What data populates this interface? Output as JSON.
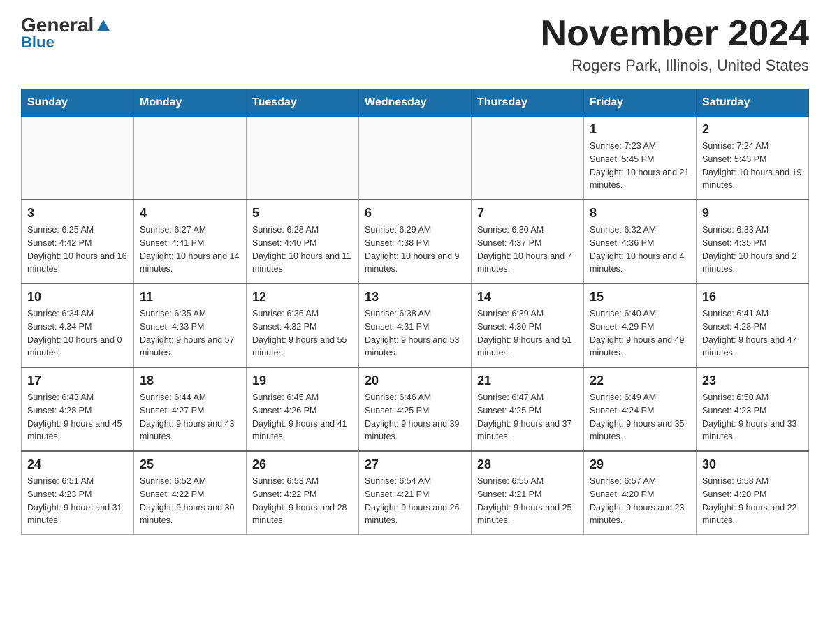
{
  "header": {
    "logo_general": "General",
    "logo_blue": "Blue",
    "month_title": "November 2024",
    "location": "Rogers Park, Illinois, United States"
  },
  "days_of_week": [
    "Sunday",
    "Monday",
    "Tuesday",
    "Wednesday",
    "Thursday",
    "Friday",
    "Saturday"
  ],
  "weeks": [
    [
      {
        "day": "",
        "info": ""
      },
      {
        "day": "",
        "info": ""
      },
      {
        "day": "",
        "info": ""
      },
      {
        "day": "",
        "info": ""
      },
      {
        "day": "",
        "info": ""
      },
      {
        "day": "1",
        "info": "Sunrise: 7:23 AM\nSunset: 5:45 PM\nDaylight: 10 hours and 21 minutes."
      },
      {
        "day": "2",
        "info": "Sunrise: 7:24 AM\nSunset: 5:43 PM\nDaylight: 10 hours and 19 minutes."
      }
    ],
    [
      {
        "day": "3",
        "info": "Sunrise: 6:25 AM\nSunset: 4:42 PM\nDaylight: 10 hours and 16 minutes."
      },
      {
        "day": "4",
        "info": "Sunrise: 6:27 AM\nSunset: 4:41 PM\nDaylight: 10 hours and 14 minutes."
      },
      {
        "day": "5",
        "info": "Sunrise: 6:28 AM\nSunset: 4:40 PM\nDaylight: 10 hours and 11 minutes."
      },
      {
        "day": "6",
        "info": "Sunrise: 6:29 AM\nSunset: 4:38 PM\nDaylight: 10 hours and 9 minutes."
      },
      {
        "day": "7",
        "info": "Sunrise: 6:30 AM\nSunset: 4:37 PM\nDaylight: 10 hours and 7 minutes."
      },
      {
        "day": "8",
        "info": "Sunrise: 6:32 AM\nSunset: 4:36 PM\nDaylight: 10 hours and 4 minutes."
      },
      {
        "day": "9",
        "info": "Sunrise: 6:33 AM\nSunset: 4:35 PM\nDaylight: 10 hours and 2 minutes."
      }
    ],
    [
      {
        "day": "10",
        "info": "Sunrise: 6:34 AM\nSunset: 4:34 PM\nDaylight: 10 hours and 0 minutes."
      },
      {
        "day": "11",
        "info": "Sunrise: 6:35 AM\nSunset: 4:33 PM\nDaylight: 9 hours and 57 minutes."
      },
      {
        "day": "12",
        "info": "Sunrise: 6:36 AM\nSunset: 4:32 PM\nDaylight: 9 hours and 55 minutes."
      },
      {
        "day": "13",
        "info": "Sunrise: 6:38 AM\nSunset: 4:31 PM\nDaylight: 9 hours and 53 minutes."
      },
      {
        "day": "14",
        "info": "Sunrise: 6:39 AM\nSunset: 4:30 PM\nDaylight: 9 hours and 51 minutes."
      },
      {
        "day": "15",
        "info": "Sunrise: 6:40 AM\nSunset: 4:29 PM\nDaylight: 9 hours and 49 minutes."
      },
      {
        "day": "16",
        "info": "Sunrise: 6:41 AM\nSunset: 4:28 PM\nDaylight: 9 hours and 47 minutes."
      }
    ],
    [
      {
        "day": "17",
        "info": "Sunrise: 6:43 AM\nSunset: 4:28 PM\nDaylight: 9 hours and 45 minutes."
      },
      {
        "day": "18",
        "info": "Sunrise: 6:44 AM\nSunset: 4:27 PM\nDaylight: 9 hours and 43 minutes."
      },
      {
        "day": "19",
        "info": "Sunrise: 6:45 AM\nSunset: 4:26 PM\nDaylight: 9 hours and 41 minutes."
      },
      {
        "day": "20",
        "info": "Sunrise: 6:46 AM\nSunset: 4:25 PM\nDaylight: 9 hours and 39 minutes."
      },
      {
        "day": "21",
        "info": "Sunrise: 6:47 AM\nSunset: 4:25 PM\nDaylight: 9 hours and 37 minutes."
      },
      {
        "day": "22",
        "info": "Sunrise: 6:49 AM\nSunset: 4:24 PM\nDaylight: 9 hours and 35 minutes."
      },
      {
        "day": "23",
        "info": "Sunrise: 6:50 AM\nSunset: 4:23 PM\nDaylight: 9 hours and 33 minutes."
      }
    ],
    [
      {
        "day": "24",
        "info": "Sunrise: 6:51 AM\nSunset: 4:23 PM\nDaylight: 9 hours and 31 minutes."
      },
      {
        "day": "25",
        "info": "Sunrise: 6:52 AM\nSunset: 4:22 PM\nDaylight: 9 hours and 30 minutes."
      },
      {
        "day": "26",
        "info": "Sunrise: 6:53 AM\nSunset: 4:22 PM\nDaylight: 9 hours and 28 minutes."
      },
      {
        "day": "27",
        "info": "Sunrise: 6:54 AM\nSunset: 4:21 PM\nDaylight: 9 hours and 26 minutes."
      },
      {
        "day": "28",
        "info": "Sunrise: 6:55 AM\nSunset: 4:21 PM\nDaylight: 9 hours and 25 minutes."
      },
      {
        "day": "29",
        "info": "Sunrise: 6:57 AM\nSunset: 4:20 PM\nDaylight: 9 hours and 23 minutes."
      },
      {
        "day": "30",
        "info": "Sunrise: 6:58 AM\nSunset: 4:20 PM\nDaylight: 9 hours and 22 minutes."
      }
    ]
  ]
}
